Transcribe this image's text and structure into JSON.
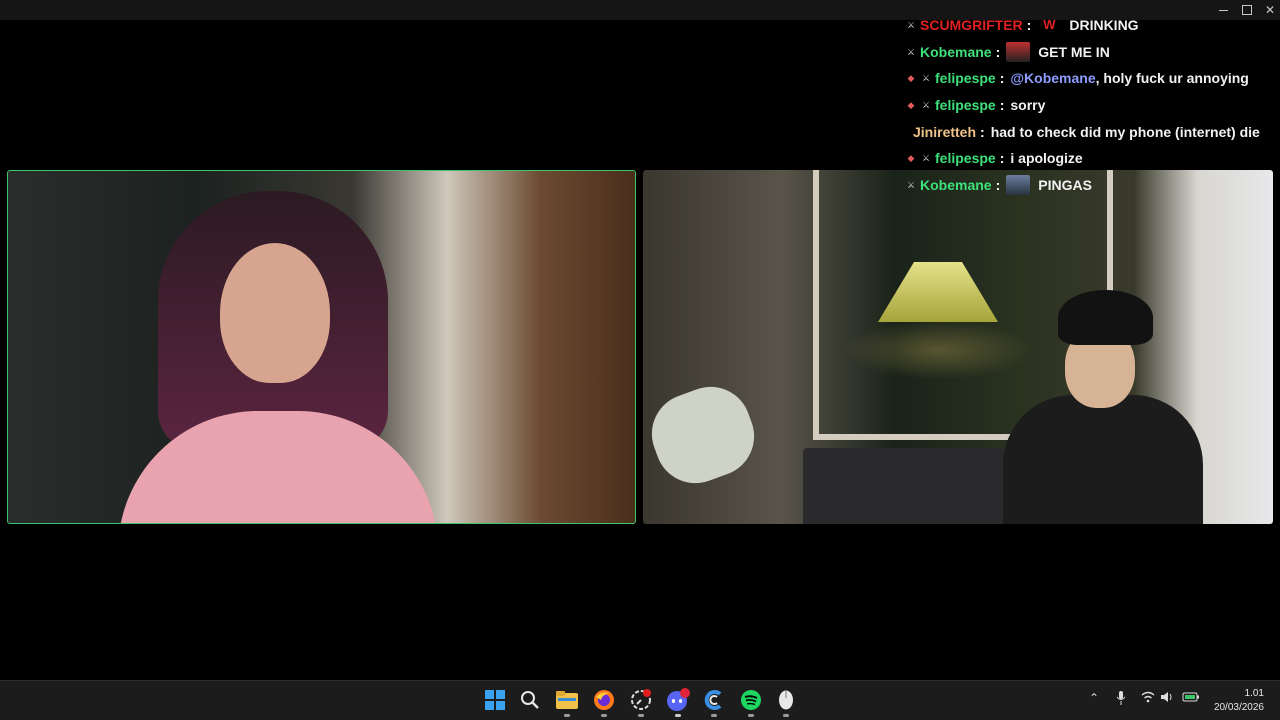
{
  "window": {
    "controls": [
      "minimize",
      "maximize",
      "close"
    ]
  },
  "chat": {
    "messages": [
      {
        "user": "SCUMGRIFTER",
        "color": "#e02020",
        "badges": [
          "mod-icon"
        ],
        "emote": "W",
        "emote_color": "#e02020",
        "text": "DRINKING",
        "mention": ""
      },
      {
        "user": "Kobemane",
        "color": "#3ee07a",
        "badges": [
          "mod-icon"
        ],
        "emote": "emote-icon",
        "text": "GET ME IN",
        "mention": ""
      },
      {
        "user": "felipespe",
        "color": "#3ee07a",
        "badges": [
          "sub-icon",
          "mod-icon"
        ],
        "emote": "",
        "mention": "@Kobemane",
        "text": ", holy fuck ur annoying"
      },
      {
        "user": "felipespe",
        "color": "#3ee07a",
        "badges": [
          "sub-icon",
          "mod-icon"
        ],
        "emote": "",
        "mention": "",
        "text": "sorry"
      },
      {
        "user": "Jiniretteh",
        "color": "#f0c38a",
        "badges": [],
        "emote": "",
        "mention": "",
        "text": "had to check did my phone (internet) die"
      },
      {
        "user": "felipespe",
        "color": "#3ee07a",
        "badges": [
          "sub-icon",
          "mod-icon"
        ],
        "emote": "",
        "mention": "",
        "text": "i apologize"
      },
      {
        "user": "Kobemane",
        "color": "#3ee07a",
        "badges": [
          "mod-icon"
        ],
        "emote": "emote-icon",
        "mention": "",
        "text": "PINGAS"
      }
    ]
  },
  "video": {
    "left_active_border": "#3ec46d",
    "tiles": [
      "participant-left",
      "participant-right"
    ]
  },
  "taskbar": {
    "apps": [
      "windows-start",
      "search",
      "file-explorer",
      "firefox",
      "clock-app",
      "discord",
      "ccleaner",
      "spotify",
      "mouse-utility"
    ],
    "discord_badge": "9+",
    "time": "1.01",
    "date": "20/03/2026"
  }
}
